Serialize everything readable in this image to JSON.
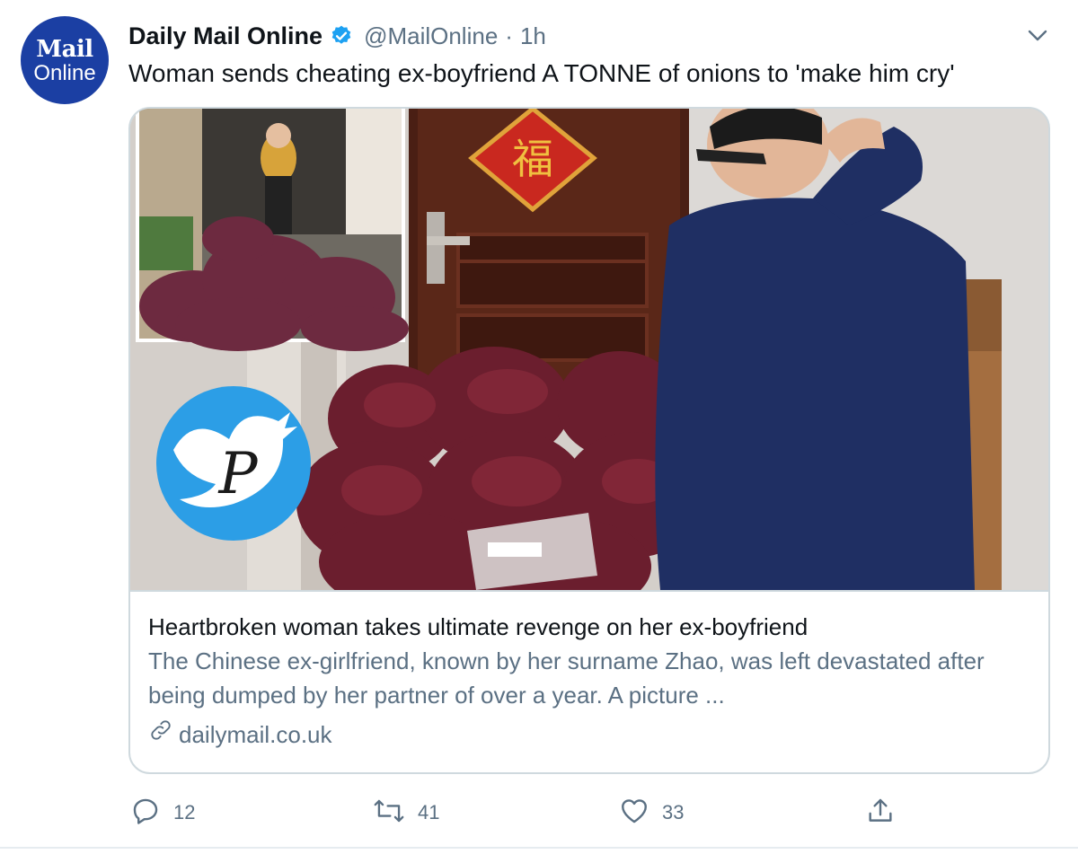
{
  "account": {
    "avatar_line1": "Mail",
    "avatar_line2": "Online",
    "display_name": "Daily Mail Online",
    "handle": "@MailOnline",
    "separator": "·",
    "time": "1h"
  },
  "tweet": {
    "text": "Woman sends cheating ex-boyfriend A TONNE of onions to 'make him cry'"
  },
  "card": {
    "title": "Heartbroken woman takes ultimate revenge on her ex-boyfriend",
    "description": "The Chinese ex-girlfriend, known by her surname Zhao, was left devastated after being dumped by her partner of over a year. A picture ...",
    "domain": "dailymail.co.uk",
    "watermark_letter": "P",
    "door_character": "福"
  },
  "actions": {
    "reply_count": "12",
    "retweet_count": "41",
    "like_count": "33"
  },
  "icons": {
    "verified": "verified-badge-icon",
    "caret": "chevron-down-icon",
    "link": "link-icon",
    "reply": "reply-icon",
    "retweet": "retweet-icon",
    "like": "heart-icon",
    "share": "share-icon"
  },
  "colors": {
    "verified_blue": "#1da1f2",
    "avatar_blue": "#1b3fa3",
    "secondary_text": "#5b7083",
    "border": "#cfd9de"
  }
}
